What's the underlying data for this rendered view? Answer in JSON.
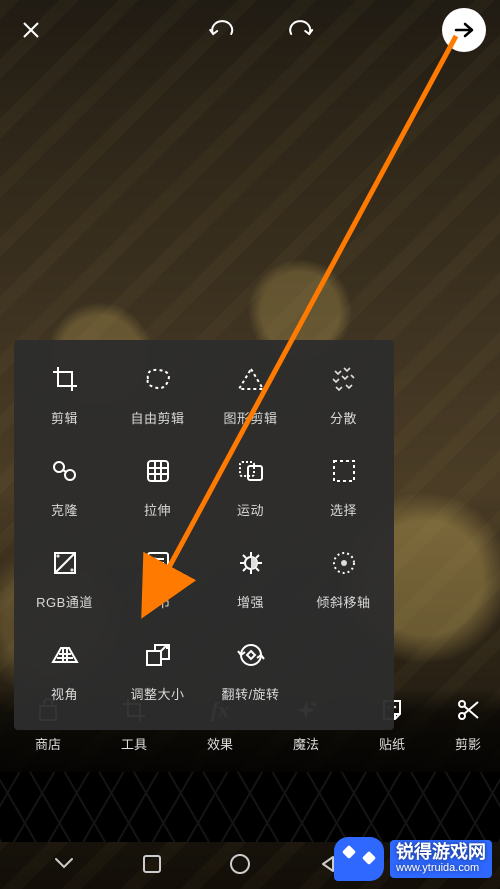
{
  "topbar": {
    "close_icon": "close",
    "undo_icon": "undo",
    "redo_icon": "redo",
    "next_icon": "arrow-right"
  },
  "panel": {
    "tools": [
      {
        "id": "crop",
        "label": "剪辑"
      },
      {
        "id": "free-crop",
        "label": "自由剪辑"
      },
      {
        "id": "shape-crop",
        "label": "图形剪辑"
      },
      {
        "id": "scatter",
        "label": "分散"
      },
      {
        "id": "clone",
        "label": "克隆"
      },
      {
        "id": "stretch",
        "label": "拉伸"
      },
      {
        "id": "motion",
        "label": "运动"
      },
      {
        "id": "select",
        "label": "选择"
      },
      {
        "id": "rgb-channel",
        "label": "RGB通道"
      },
      {
        "id": "adjust",
        "label": "调节"
      },
      {
        "id": "enhance",
        "label": "增强"
      },
      {
        "id": "tilt-shift",
        "label": "倾斜移轴"
      },
      {
        "id": "perspective",
        "label": "视角"
      },
      {
        "id": "resize",
        "label": "调整大小"
      },
      {
        "id": "flip-rotate",
        "label": "翻转/旋转"
      }
    ]
  },
  "categories": [
    {
      "id": "shop",
      "label": "商店"
    },
    {
      "id": "tools",
      "label": "工具"
    },
    {
      "id": "effects",
      "label": "效果"
    },
    {
      "id": "magic",
      "label": "魔法"
    },
    {
      "id": "sticker",
      "label": "贴纸"
    },
    {
      "id": "cutout",
      "label": "剪影"
    }
  ],
  "watermark": {
    "brand": "锐得游戏网",
    "url": "www.ytruida.com"
  }
}
